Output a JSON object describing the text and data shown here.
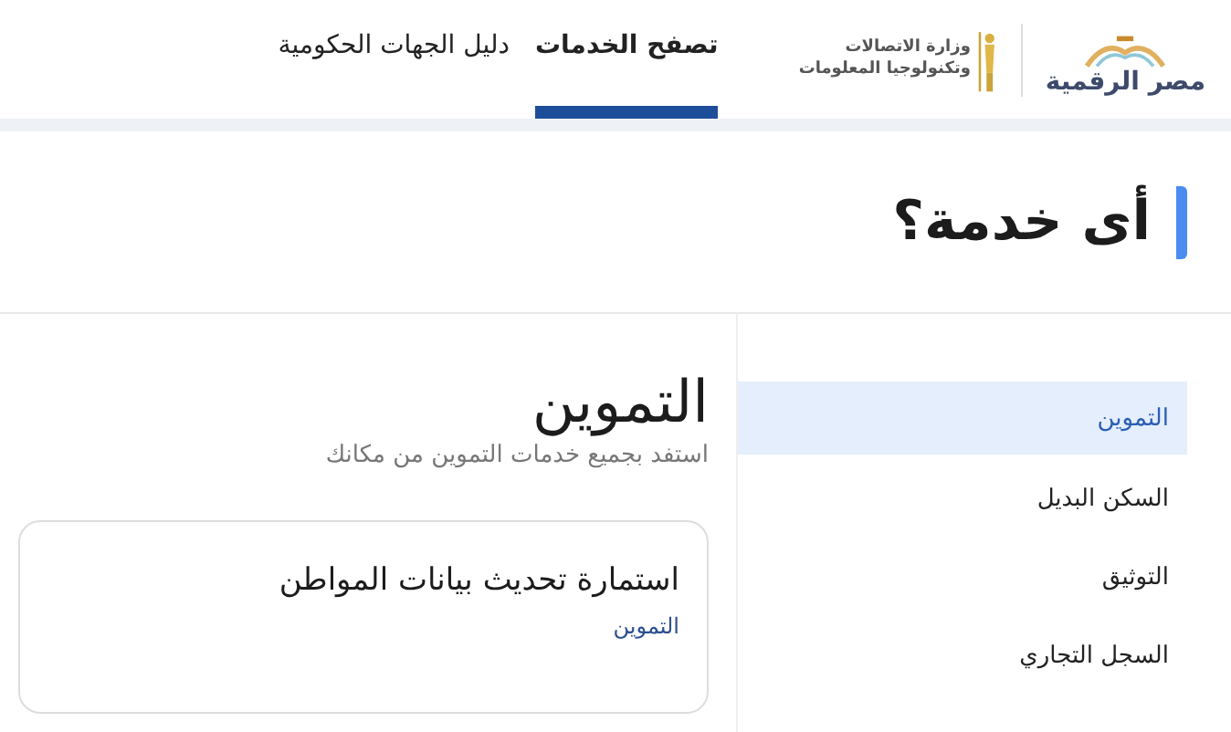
{
  "header": {
    "logos": [
      {
        "kind": "digital",
        "text": "مصر الرقمية"
      },
      {
        "kind": "ministry",
        "lines": [
          "وزارة الاتصالات",
          "وتكنولوجيا المعلومات"
        ]
      }
    ],
    "tabs": [
      {
        "label": "تصفح الخدمات",
        "selected": true
      },
      {
        "label": "دليل الجهات الحكومية",
        "selected": false
      }
    ]
  },
  "hero": {
    "title": "أى خدمة؟"
  },
  "sidebar": {
    "items": [
      {
        "label": "التموين",
        "selected": true
      },
      {
        "label": "السكن البديل",
        "selected": false
      },
      {
        "label": "التوثيق",
        "selected": false
      },
      {
        "label": "السجل التجاري",
        "selected": false
      }
    ]
  },
  "main": {
    "title": "التموين",
    "subtitle": "استفد بجميع خدمات التموين من مكانك",
    "cards": [
      {
        "title": "استمارة تحديث بيانات المواطن",
        "category": "التموين"
      }
    ]
  }
}
